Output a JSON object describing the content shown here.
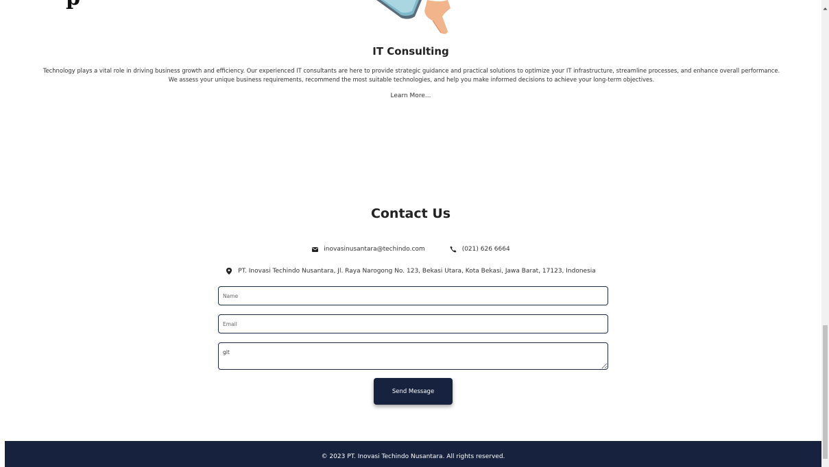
{
  "service": {
    "title": "IT Consulting",
    "description": "Technology plays a vital role in driving business growth and efficiency. Our experienced IT consultants are here to provide strategic guidance and practical solutions to optimize your IT infrastructure, streamline processes, and enhance overall performance. We assess your unique business requirements, recommend the most suitable technologies, and help you make informed decisions to achieve your long-term objectives.",
    "learn_more": "Learn More...",
    "icon": "consulting-illustration"
  },
  "contact": {
    "title": "Contact Us",
    "email": "inovasinusantara@techindo.com",
    "phone": "(021) 626 6664",
    "address": "PT. Inovasi Techindo Nusantara, Jl. Raya Narogong No. 123, Bekasi Utara, Kota Bekasi, Jawa Barat, 17123, Indonesia",
    "icons": {
      "email": "envelope-icon",
      "phone": "phone-icon",
      "address": "map-pin-icon"
    }
  },
  "form": {
    "name_placeholder": "Name",
    "email_placeholder": "Email",
    "message_value": "git",
    "send_label": "Send Message"
  },
  "footer": {
    "text": "© 2023 PT. Inovasi Techindo Nusantara. All rights reserved."
  },
  "colors": {
    "navy": "#17223f",
    "text": "#333333",
    "background": "#ffffff"
  }
}
